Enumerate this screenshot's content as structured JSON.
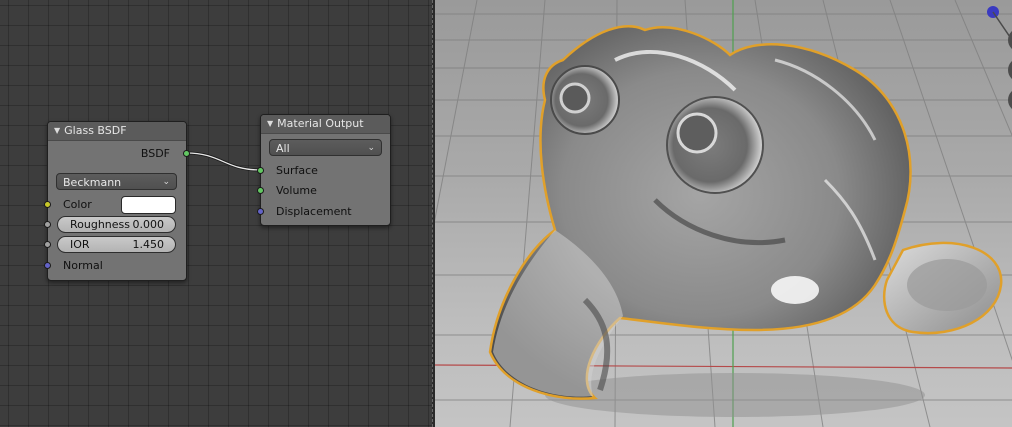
{
  "node_editor": {
    "glass_node": {
      "title": "Glass BSDF",
      "output_socket": "BSDF",
      "distribution": "Beckmann",
      "color_label": "Color",
      "color_value": "#ffffff",
      "roughness": {
        "label": "Roughness",
        "value": "0.000"
      },
      "ior": {
        "label": "IOR",
        "value": "1.450"
      },
      "normal_label": "Normal"
    },
    "output_node": {
      "title": "Material Output",
      "target": "All",
      "inputs": [
        "Surface",
        "Volume",
        "Displacement"
      ]
    }
  },
  "viewport": {
    "object": "glass-monkey-head",
    "selection_outline_color": "#e0a02a",
    "axis_colors": {
      "x": "#b54a4a",
      "y": "#4fa04f"
    },
    "gizmo_dot_color": "#3a3ac0"
  },
  "colors": {
    "socket_shader": "#63c763",
    "socket_color": "#c7c729",
    "socket_float": "#a1a1a1",
    "socket_vector": "#6363c7",
    "node_body": "#737373",
    "node_header": "#5b5b5b"
  }
}
